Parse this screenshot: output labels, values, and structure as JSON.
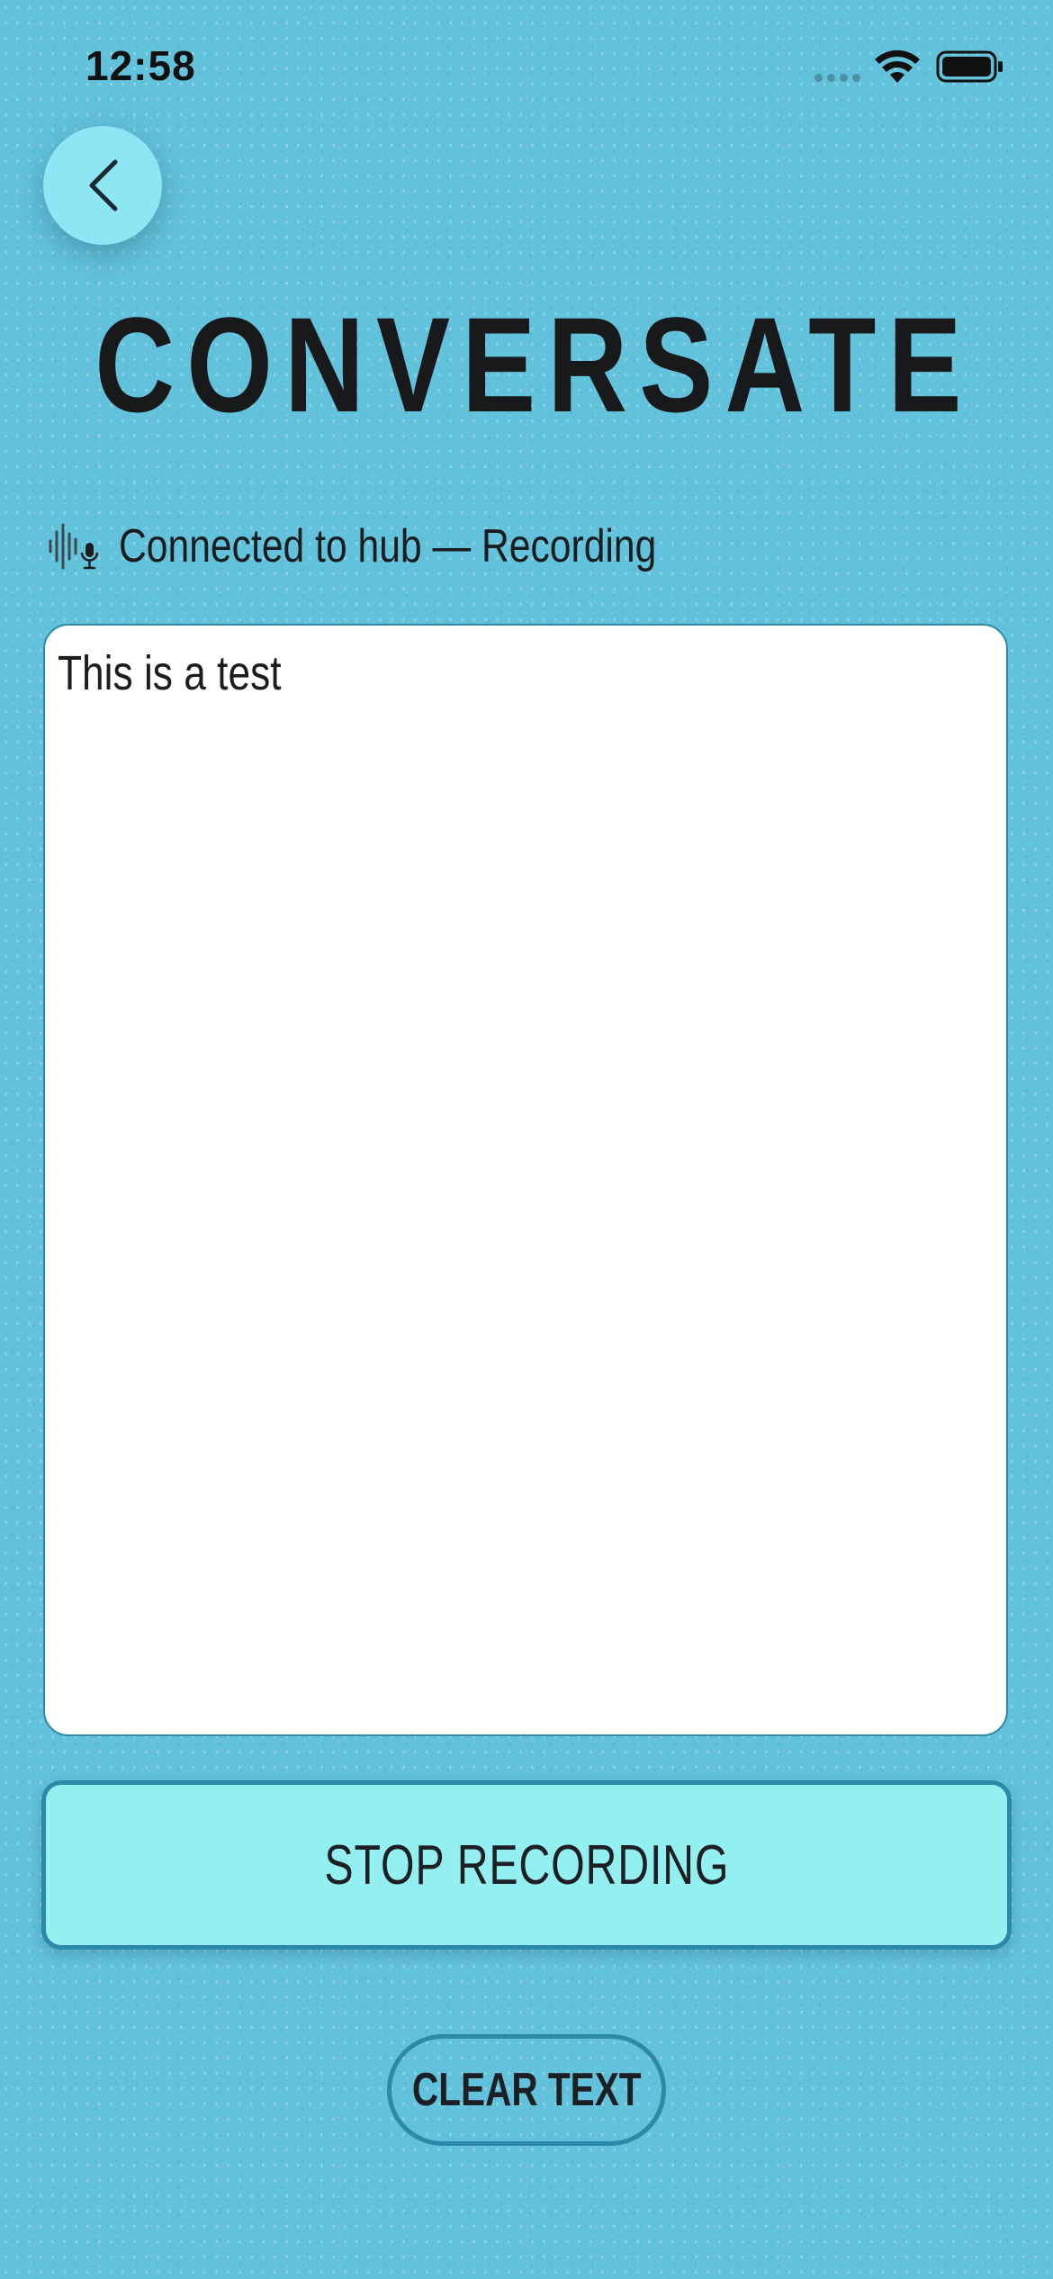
{
  "status_bar": {
    "time": "12:58"
  },
  "icons": {
    "back": "chevron-left-icon",
    "wifi": "wifi-icon",
    "battery": "battery-icon",
    "status": "microphone-waveform-icon"
  },
  "header": {
    "title": "CONVERSATE"
  },
  "connection": {
    "status_text": "Connected to hub — Recording"
  },
  "transcript": {
    "text": "This is a test"
  },
  "actions": {
    "stop_label": "STOP RECORDING",
    "clear_label": "CLEAR TEXT"
  },
  "colors": {
    "background": "#62c1db",
    "accent_button": "#94f0f0",
    "border": "#2a8aa8",
    "back_button": "#8ee5f3"
  }
}
